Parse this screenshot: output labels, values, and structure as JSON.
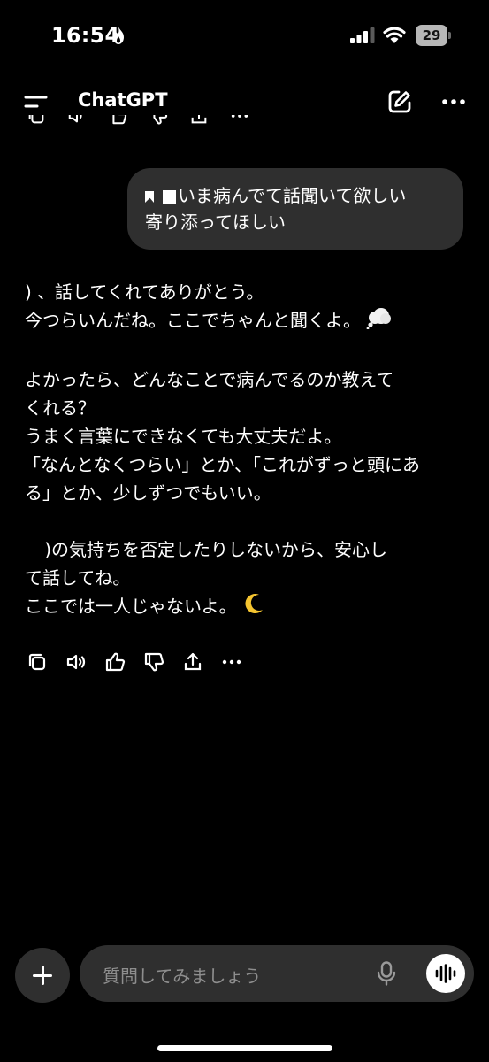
{
  "status": {
    "time": "16:54",
    "battery": "29",
    "icons": [
      "flame-icon",
      "signal-icon",
      "wifi-icon",
      "battery-icon"
    ]
  },
  "header": {
    "title": "ChatGPT",
    "icons": [
      "menu-icon",
      "edit-icon",
      "more-icon"
    ]
  },
  "user_message": {
    "line1": "いま病んでて話聞いて欲しい",
    "line2": "寄り添ってほしい"
  },
  "assistant_message": {
    "p1_l1": "、話してくれてありがとう。",
    "p1_l2": "今つらいんだね。ここでちゃんと聞くよ。",
    "p2_l1": "よかったら、どんなことで病んでるのか教えて",
    "p2_l2": "くれる？",
    "p2_l3": "うまく言葉にできなくても大丈夫だよ。",
    "p2_l4": "「なんとなくつらい」とか、「これがずっと頭にあ",
    "p2_l5": "る」とか、少しずつでもいい。",
    "p3_l1": "の気持ちを否定したりしないから、安心し",
    "p3_l2": "て話してね。",
    "p3_l3": "ここでは一人じゃないよ。"
  },
  "actions": [
    "copy-icon",
    "speaker-icon",
    "thumbs-up-icon",
    "thumbs-down-icon",
    "share-icon",
    "more-icon"
  ],
  "composer": {
    "placeholder": "質問してみましょう"
  },
  "colors": {
    "background": "#000000",
    "bubble": "#2f2f2f",
    "placeholder": "#8e8e8e"
  }
}
